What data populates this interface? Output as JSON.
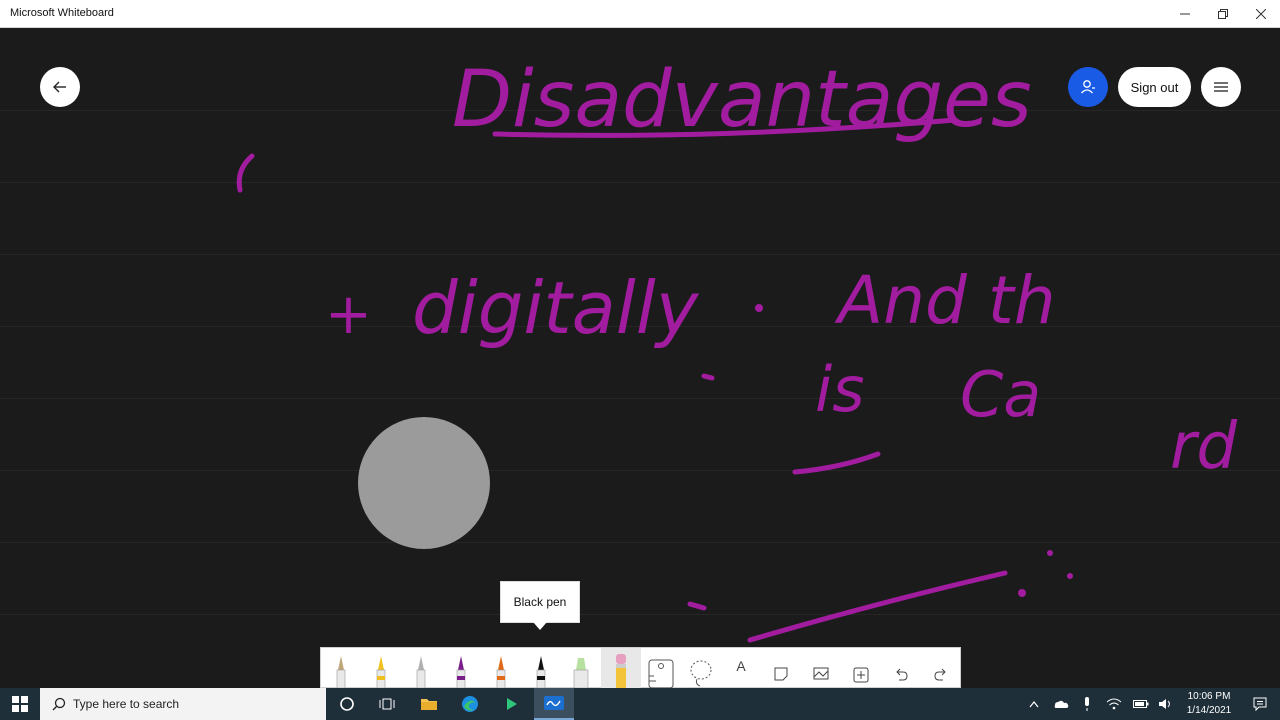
{
  "window": {
    "title": "Microsoft Whiteboard"
  },
  "header": {
    "sign_out_label": "Sign out"
  },
  "board": {
    "ink_color": "#a21c9f",
    "ink_texts": {
      "heading": "Disadvantages",
      "digitally": "digitally",
      "and_th": "And th",
      "is": "is",
      "ca": "Ca",
      "rd": "rd"
    }
  },
  "tooltip": {
    "label": "Black pen"
  },
  "toolbar": {
    "tools": [
      {
        "name": "pen-icon",
        "color": "#bfa67a"
      },
      {
        "name": "pen-icon",
        "color": "#f0c020"
      },
      {
        "name": "pen-icon",
        "color": "#b0b0b0"
      },
      {
        "name": "pen-icon",
        "color": "#7a1f8a"
      },
      {
        "name": "pen-icon",
        "color": "#e06a1a"
      },
      {
        "name": "pen-icon",
        "color": "#111111"
      },
      {
        "name": "highlighter-icon",
        "color": "#b8e0a0"
      },
      {
        "name": "eraser-icon",
        "color": "#e8a0c0"
      },
      {
        "name": "ruler-icon"
      },
      {
        "name": "lasso-icon"
      },
      {
        "name": "text-icon",
        "glyph": "A"
      },
      {
        "name": "sticky-note-icon"
      },
      {
        "name": "image-icon"
      },
      {
        "name": "add-icon"
      },
      {
        "name": "undo-icon"
      },
      {
        "name": "redo-icon"
      }
    ]
  },
  "taskbar": {
    "search_placeholder": "Type here to search",
    "time": "10:06 PM",
    "date": "1/14/2021"
  }
}
